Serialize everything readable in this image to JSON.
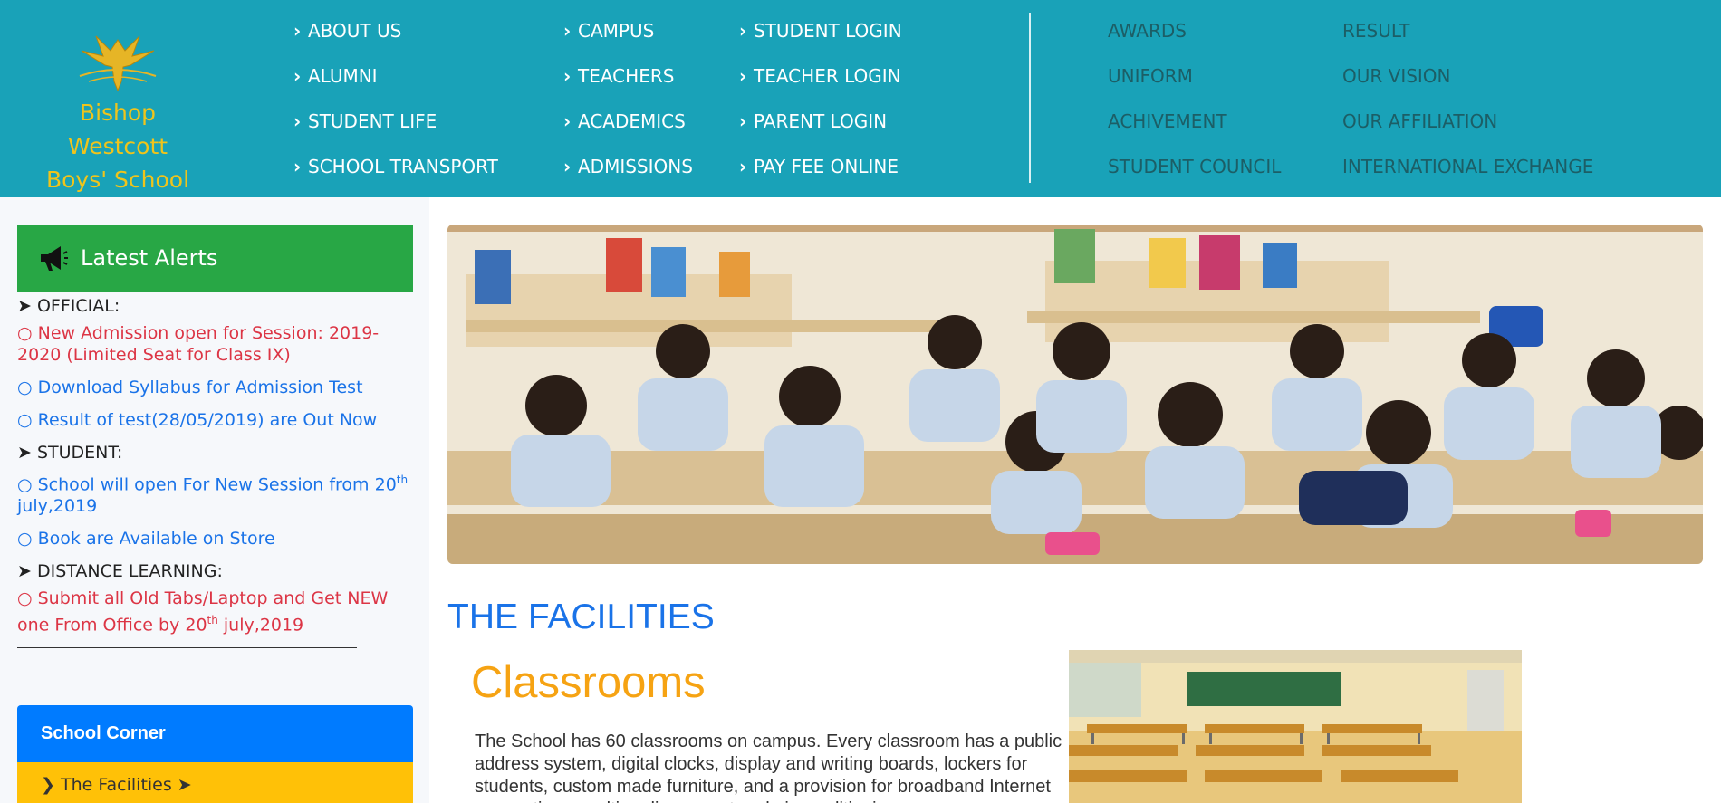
{
  "logo": {
    "line1": "Bishop Westcott",
    "line2": "Boys' School",
    "icon": "eagle-emblem-icon"
  },
  "nav": {
    "col1": [
      "ABOUT US",
      "ALUMNI",
      "STUDENT LIFE",
      "SCHOOL TRANSPORT"
    ],
    "col2": [
      "CAMPUS",
      "TEACHERS",
      "ACADEMICS",
      "ADMISSIONS"
    ],
    "col3": [
      "STUDENT LOGIN",
      "TEACHER LOGIN",
      "PARENT LOGIN",
      "PAY FEE ONLINE"
    ],
    "col4": [
      "AWARDS",
      "UNIFORM",
      "ACHIVEMENT",
      "STUDENT COUNCIL"
    ],
    "col5": [
      "RESULT",
      "OUR VISION",
      "OUR AFFILIATION",
      "INTERNATIONAL EXCHANGE"
    ],
    "chevron": "›"
  },
  "alerts": {
    "title": "Latest Alerts",
    "icon": "megaphone-icon",
    "official_label": "➤ OFFICIAL:",
    "official_1": "○ New Admission open for Session: 2019-2020 (Limited Seat for Class IX)",
    "official_2": "○ Download Syllabus for Admission Test",
    "official_3": "○ Result of test(28/05/2019) are Out Now",
    "student_label": "➤ STUDENT:",
    "student_1_a": "○ School will open For New Session from 20",
    "student_1_sup": "th",
    "student_1_b": " july,2019",
    "student_2": "○ Book are Available on Store",
    "distance_label": "➤ DISTANCE LEARNING:",
    "distance_1_a": "○ Submit all Old Tabs/Laptop and Get NEW one From Office by 20",
    "distance_1_sup": "th",
    "distance_1_b": " july,2019"
  },
  "corner": {
    "title": "School Corner",
    "item": "❯ The Facilities ➤"
  },
  "main": {
    "facilities_title": "THE FACILITIES",
    "classrooms_title": "Classrooms",
    "classrooms_text": "The School has 60 classrooms on campus. Every classroom has a public address system, digital clocks, display and writing boards, lockers for students, custom made furniture, and a provision for broadband Internet connections, multimedia support and air conditioning."
  },
  "colors": {
    "header": "#19a2b8",
    "alerts_head": "#28a745",
    "corner_head": "#007bff",
    "corner_item": "#ffc107",
    "title_blue": "#1a73e8",
    "title_orange": "#f6a313",
    "logo_gold": "#f0c41b"
  }
}
